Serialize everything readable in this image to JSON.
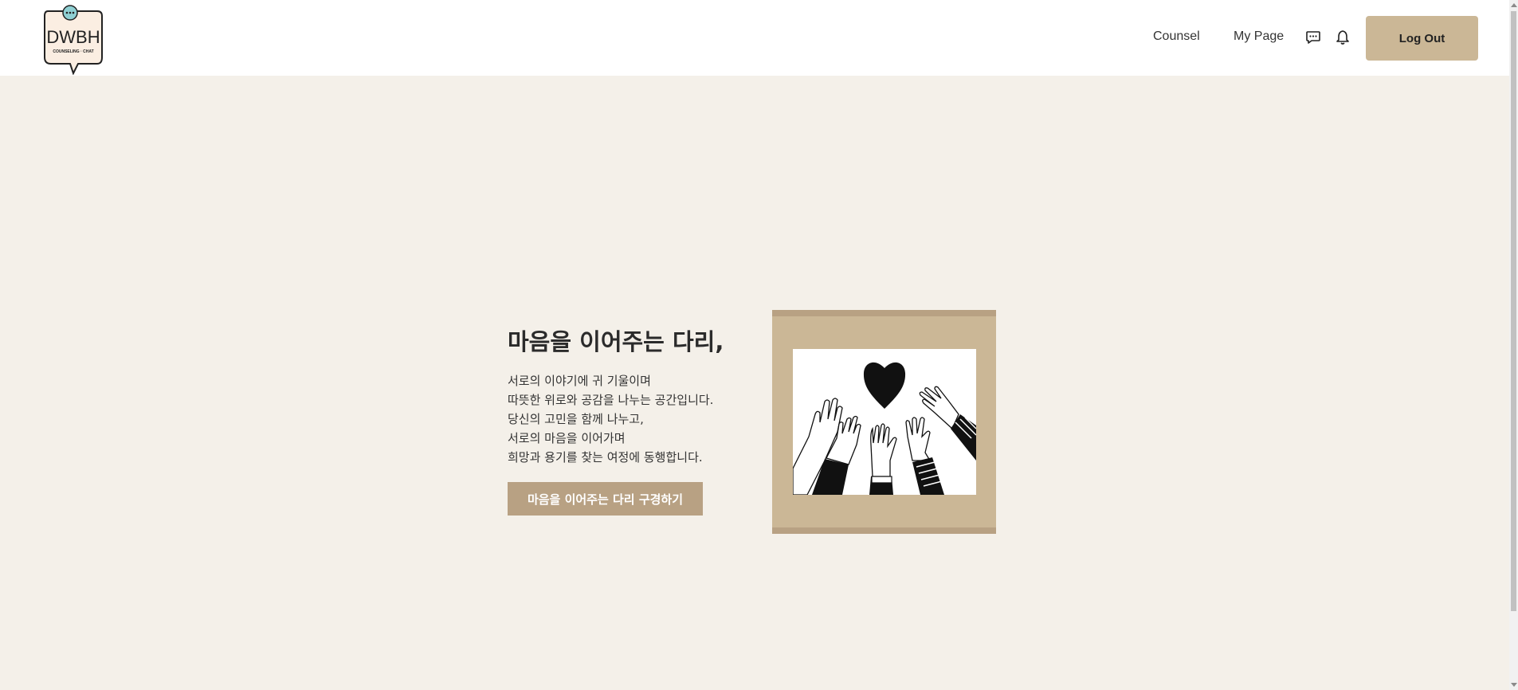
{
  "header": {
    "logo_text": "DWBH",
    "logo_subtext": "COUNSELING · CHAT",
    "nav": {
      "counsel": "Counsel",
      "my_page": "My Page"
    },
    "icons": [
      "chat-bubble-icon",
      "bell-icon"
    ],
    "logout_label": "Log Out"
  },
  "hero": {
    "title": "마음을 이어주는 다리,",
    "lines": [
      "서로의 이야기에 귀 기울이며",
      "따뜻한 위로와 공감을 나누는 공간입니다.",
      "당신의 고민을 함께 나누고,",
      "서로의 마음을 이어가며",
      "희망과 용기를 찾는 여정에 동행합니다."
    ],
    "cta_label": "마음을 이어주는 다리 구경하기"
  },
  "colors": {
    "background": "#f4f0e9",
    "accent": "#cbb796",
    "cta": "#b8a183"
  }
}
